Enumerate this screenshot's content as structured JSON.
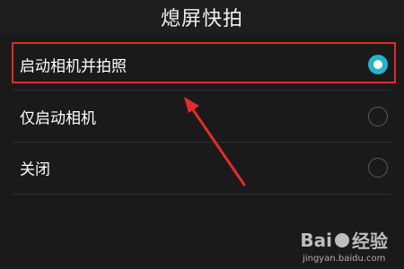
{
  "header": {
    "title": "熄屏快拍"
  },
  "options": [
    {
      "label": "启动相机并拍照",
      "selected": true
    },
    {
      "label": "仅启动相机",
      "selected": false
    },
    {
      "label": "关闭",
      "selected": false
    }
  ],
  "annotation": {
    "highlight_color": "#e32b2b",
    "arrow_color": "#e32b2b"
  },
  "watermark": {
    "brand_left": "Bai",
    "brand_right": "经验",
    "url": "jingyan.baidu.com"
  },
  "colors": {
    "background": "#1a1a1a",
    "accent": "#27b3c7"
  }
}
